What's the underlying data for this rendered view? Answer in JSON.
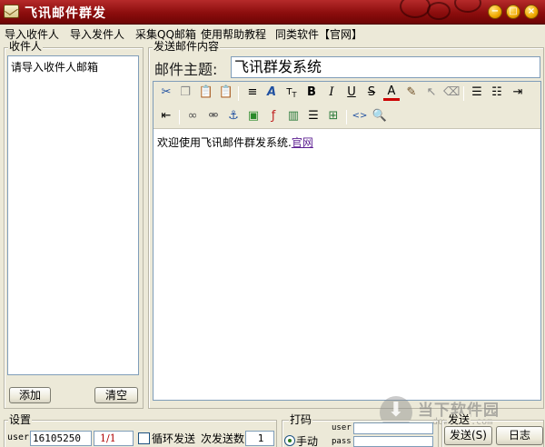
{
  "window": {
    "title": "飞讯邮件群发",
    "controls": {
      "minimize": "−",
      "maximize": "□",
      "close": "×"
    }
  },
  "menu": {
    "items": [
      "导入收件人",
      "导入发件人",
      "采集QQ邮箱",
      "使用帮助教程",
      "同类软件【官网】"
    ]
  },
  "recipients": {
    "group_label": "收件人",
    "list_items": [
      "请导入收件人邮箱"
    ],
    "add_button": "添加",
    "clear_button": "清空"
  },
  "compose": {
    "group_label": "发送邮件内容",
    "subject_label": "邮件主题:",
    "subject_value": "飞讯群发系统",
    "body_text": "欢迎使用飞讯邮件群发系统.",
    "body_link": "官网"
  },
  "settings": {
    "group_label": "设置",
    "user_label": "user",
    "user_value": "16105250",
    "page_counter": "1/1",
    "loop_send_label": "循环发送",
    "send_count_label": "次发送数",
    "send_count_value": "1"
  },
  "captcha": {
    "group_label": "打码",
    "manual_label": "手动",
    "user_label": "user",
    "pass_label": "pass"
  },
  "send": {
    "group_label": "发送",
    "send_button": "发送(S)",
    "log_button": "日志"
  },
  "watermark": {
    "brand": "当下软件园",
    "domain": "downxia.com"
  },
  "colors": {
    "titlebar": "#8c0d0d",
    "accent_link": "#5b1d90",
    "counter_red": "#b00000"
  }
}
